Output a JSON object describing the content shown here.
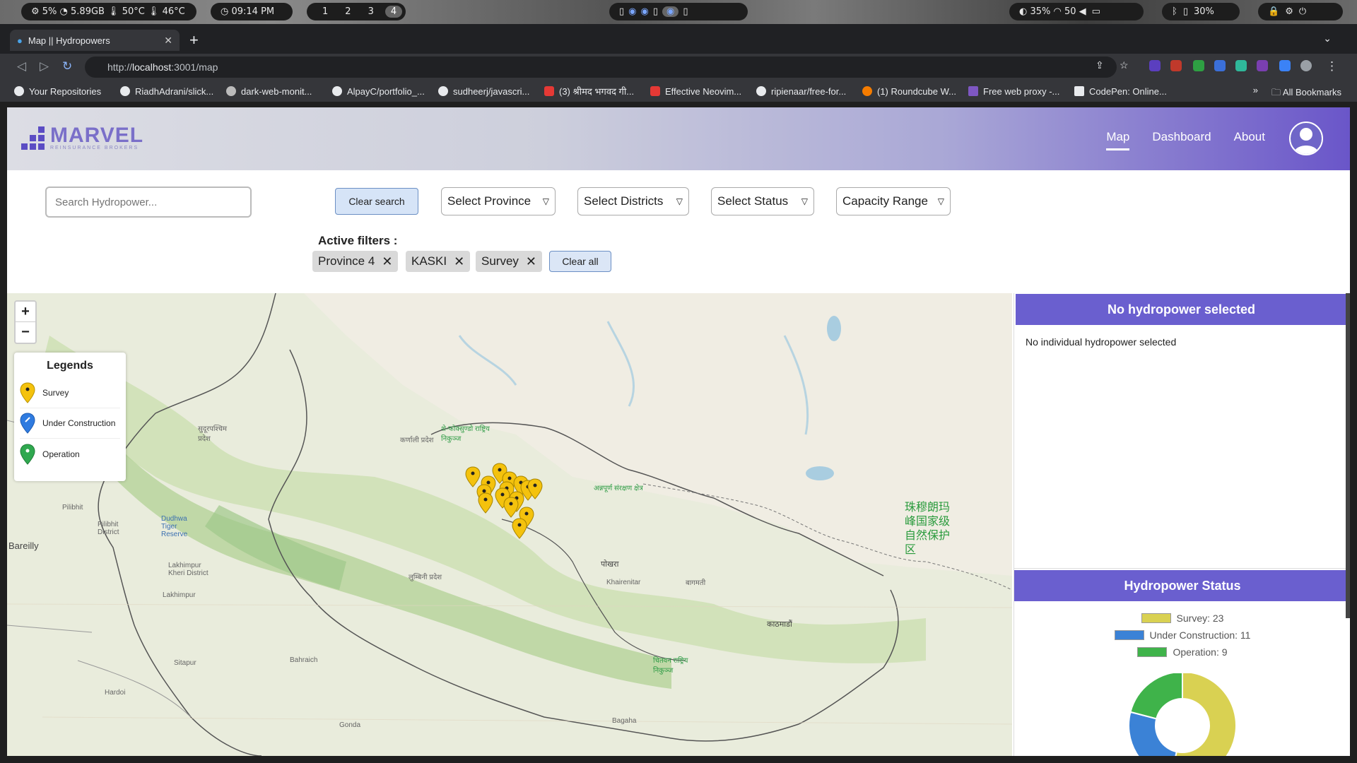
{
  "system_bar": {
    "left_status": "⚙ 5% ◔ 5.89GB 🌡 50°C 🌡 46°C",
    "clock": "◷ 09:14 PM",
    "workspaces": [
      "1",
      "2",
      "3",
      "4"
    ],
    "right_status_1": "◐ 35%  ◠ 50  ◀ ",
    "right_status_2": "30%"
  },
  "browser": {
    "tab_title": "Map || Hydropowers",
    "url_prefix": "http://",
    "url_host": "localhost",
    "url_rest": ":3001/map",
    "bookmarks": [
      "Your Repositories",
      "RiadhAdrani/slick...",
      "dark-web-monit...",
      "AlpayC/portfolio_...",
      "sudheerj/javascri...",
      "(3) श्रीमद भगवद गी...",
      "Effective Neovim...",
      "ripienaar/free-for...",
      "(1) Roundcube W...",
      "Free web proxy -...",
      "CodePen: Online..."
    ],
    "all_bookmarks": "All Bookmarks"
  },
  "app": {
    "logo_text": "MARVEL",
    "logo_sub": "REINSURANCE BROKERS",
    "nav": [
      "Map",
      "Dashboard",
      "About"
    ],
    "search_placeholder": "Search Hydropower...",
    "clear_search": "Clear search",
    "selects": {
      "province": "Select Province",
      "districts": "Select Districts",
      "status": "Select Status",
      "capacity": "Capacity Range"
    },
    "active_filters_label": "Active filters :",
    "chips": [
      "Province 4",
      "KASKI",
      "Survey"
    ],
    "clear_all": "Clear all",
    "legend": {
      "title": "Legends",
      "items": [
        "Survey",
        "Under Construction",
        "Operation"
      ]
    },
    "panel": {
      "title": "No hydropower selected",
      "body": "No individual hydropower selected"
    },
    "status_panel": {
      "title": "Hydropower Status",
      "items": [
        "Survey: 23",
        "Under Construction: 11",
        "Operation: 9"
      ]
    }
  },
  "map_labels": {
    "bareilly": "Bareilly",
    "pilibhit": "Pilibhit",
    "lakhimpur": "Lakhimpur",
    "sitapur": "Sitapur",
    "hardoi": "Hardoi",
    "bahraich": "Bahraich",
    "gonda": "Gonda",
    "bagaha": "Bagaha",
    "khairenitar": "Khairenitar",
    "kathmandu": "काठमाडौं",
    "pokhara": "पोखरा",
    "china_reserve": "珠穆朗玛峰国家级自然保护区",
    "annapurna": "अन्नपूर्ण संरक्षण क्षेत्र",
    "sheyphoksundo": "शे-फोक्सुण्डो राष्ट्रिय निकुञ्ज",
    "karnali": "कर्णाली प्रदेश",
    "sudurpashchim": "सुदूरपश्चिम प्रदेश",
    "lumbini": "लुम्बिनी प्रदेश",
    "bagmati": "बागमती",
    "dudhwa": "Dudhwa Tiger Reserve",
    "pilibhit_district": "Pilibhit District",
    "lakhimpur_district": "Lakhimpur Kheri District",
    "chitwan": "चितवन राष्ट्रिय निकुञ्ज"
  },
  "chart_data": {
    "type": "pie",
    "categories": [
      "Survey",
      "Under Construction",
      "Operation"
    ],
    "values": [
      23,
      11,
      9
    ],
    "colors": [
      "#d9d152",
      "#3b82d6",
      "#3fb34a"
    ]
  }
}
